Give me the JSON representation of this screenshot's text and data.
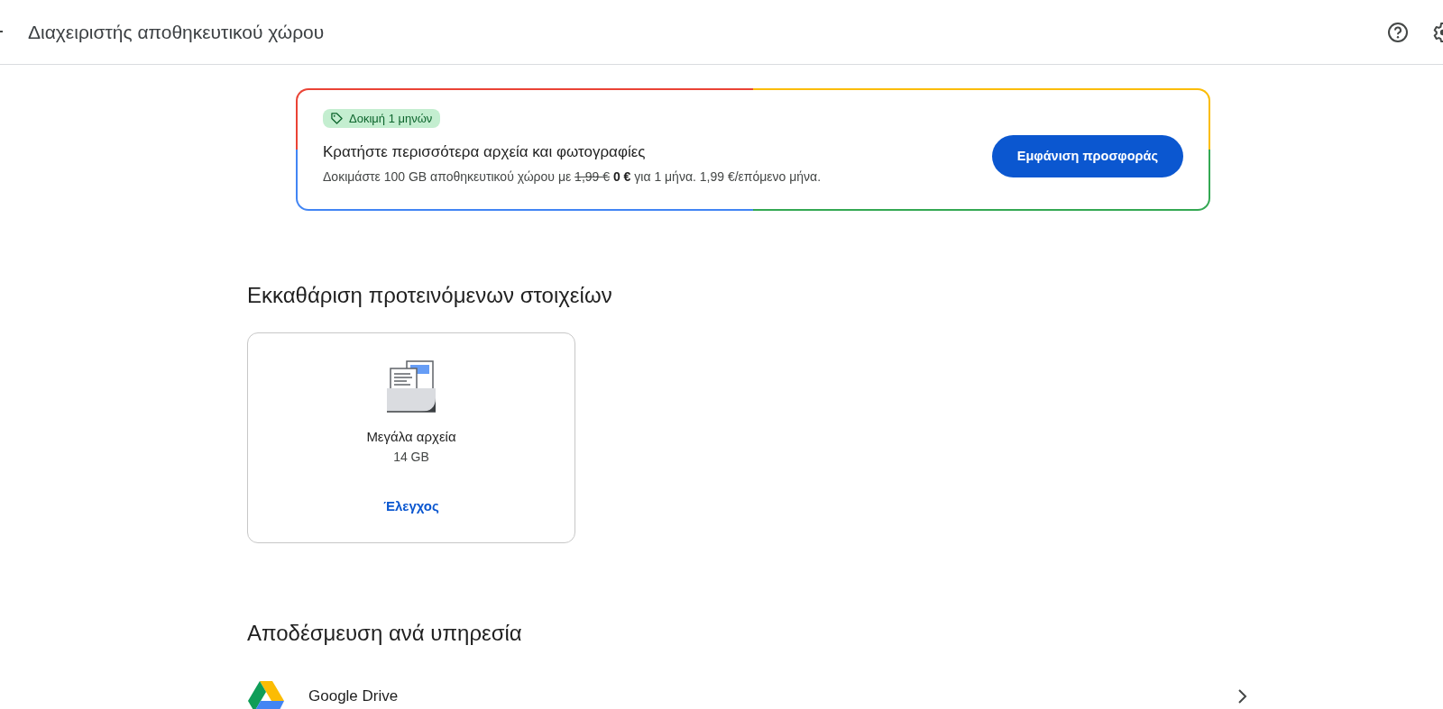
{
  "header": {
    "title": "Διαχειριστής αποθηκευτικού χώρου"
  },
  "offer": {
    "badge": "Δοκιμή 1 μηνών",
    "title": "Κρατήστε περισσότερα αρχεία και φωτογραφίες",
    "text_before": "Δοκιμάστε 100 GB αποθηκευτικού χώρου με",
    "old_price": "1,99 €",
    "new_price": "0 €",
    "text_after": "για 1 μήνα. 1,99 €/επόμενο μήνα.",
    "button": "Εμφάνιση προσφοράς"
  },
  "cleanup": {
    "heading": "Εκκαθάριση προτεινόμενων στοιχείων",
    "cards": [
      {
        "title": "Μεγάλα αρχεία",
        "size": "14 GB",
        "action": "Έλεγχος"
      }
    ]
  },
  "services": {
    "heading": "Αποδέσμευση ανά υπηρεσία",
    "items": [
      {
        "name": "Google Drive"
      }
    ]
  }
}
